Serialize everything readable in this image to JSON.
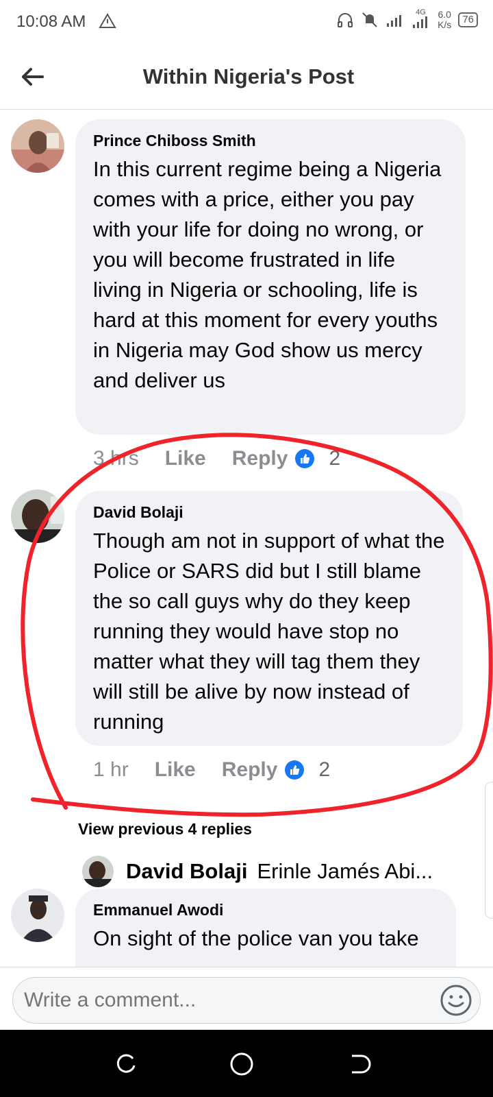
{
  "status_bar": {
    "time": "10:08 AM",
    "network": "4G",
    "speed_value": "6.0",
    "speed_unit": "K/s",
    "battery": "76",
    "icons": [
      "warning-icon",
      "headphones-icon",
      "mute-icon",
      "signal-icon",
      "signal-4g-icon"
    ]
  },
  "header": {
    "title": "Within Nigeria's Post",
    "back_icon": "arrow-left-icon"
  },
  "comments": [
    {
      "author": "Prince Chiboss Smith",
      "text": "In this current regime being a Nigeria comes with a price, either you pay with your life for doing no wrong, or you will become frustrated in life living in Nigeria or schooling, life is hard at this moment for every youths in Nigeria may God show us mercy and deliver us",
      "time": "3 hrs",
      "like_label": "Like",
      "reply_label": "Reply",
      "reaction_count": "2"
    },
    {
      "author": "David Bolaji",
      "text": "Though am not in support of what the Police or SARS did but I still blame the so call guys why do they keep running they would have stop no matter what they will tag them they will still be alive by now instead of running",
      "time": "1 hr",
      "like_label": "Like",
      "reply_label": "Reply",
      "reaction_count": "2"
    },
    {
      "author": "Emmanuel Awodi",
      "text": "On sight of the police van you take"
    }
  ],
  "replies": {
    "view_previous": "View previous 4 replies",
    "latest": {
      "author": "David Bolaji",
      "text": "Erinle Jamés Abi..."
    }
  },
  "composer": {
    "placeholder": "Write a comment...",
    "emoji_icon": "smiley-icon"
  },
  "colors": {
    "bubble": "#f0f2f5",
    "like_blue": "#1877f2",
    "annotation_red": "#f0232b"
  }
}
